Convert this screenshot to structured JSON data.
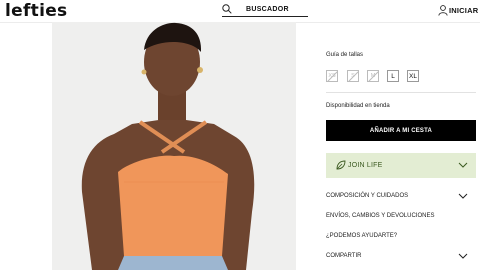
{
  "header": {
    "logo": "lefties",
    "search_label": "BUSCADOR",
    "login_label": "INICIAR S"
  },
  "product": {
    "photo_icon": "model-wearing-orange-halter-top"
  },
  "panel": {
    "size_guide": "Guía de tallas",
    "sizes": [
      {
        "label": "XS",
        "available": false
      },
      {
        "label": "S",
        "available": false
      },
      {
        "label": "M",
        "available": false
      },
      {
        "label": "L",
        "available": true
      },
      {
        "label": "XL",
        "available": true
      }
    ],
    "availability": "Disponibilidad en tienda",
    "add_button": "AÑADIR A MI CESTA",
    "join_life": "JOIN LIFE",
    "join_color": "#e3edd3",
    "accordion": [
      "COMPOSICIÓN Y CUIDADOS",
      "ENVÍOS, CAMBIOS Y DEVOLUCIONES",
      "¿PODEMOS AYUDARTE?",
      "COMPARTIR"
    ]
  }
}
